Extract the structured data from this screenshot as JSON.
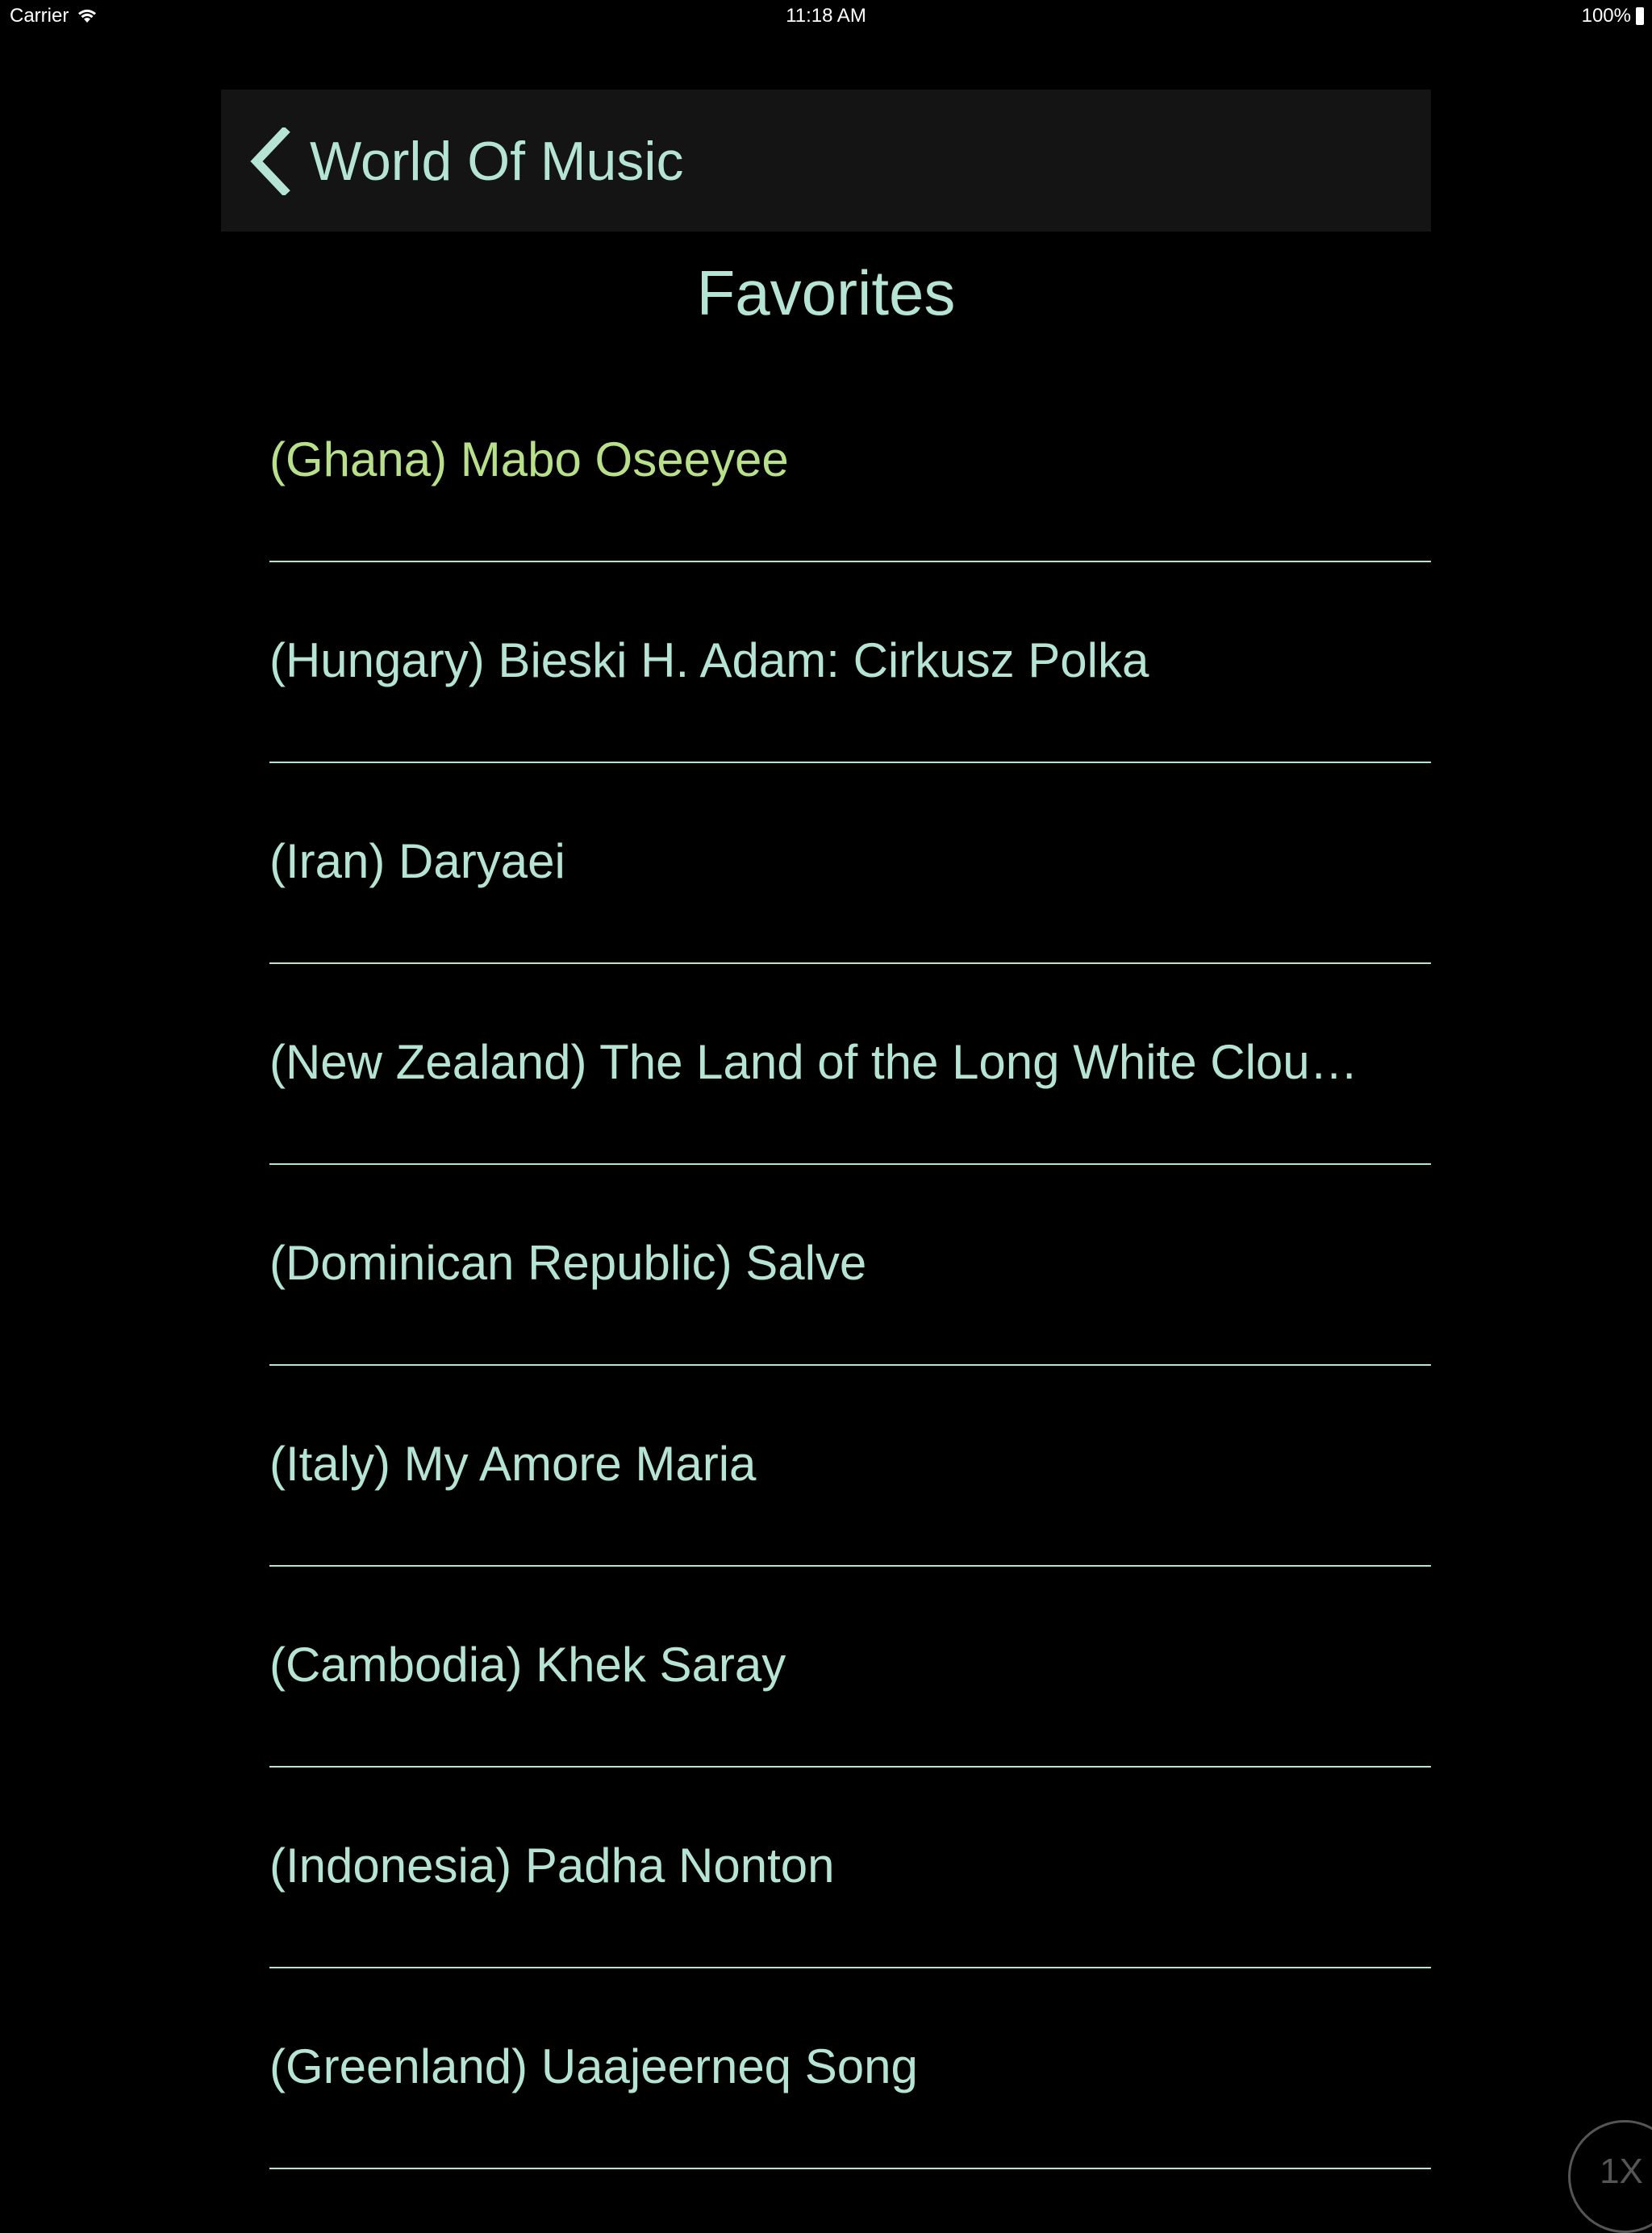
{
  "status_bar": {
    "carrier": "Carrier",
    "time": "11:18 AM",
    "battery": "100%"
  },
  "nav": {
    "back_label": "World Of Music"
  },
  "page": {
    "title": "Favorites"
  },
  "favorites": [
    {
      "label": "(Ghana) Mabo Oseeyee",
      "active": true
    },
    {
      "label": "(Hungary) Bieski H. Adam: Cirkusz Polka",
      "active": false
    },
    {
      "label": "(Iran) Daryaei",
      "active": false
    },
    {
      "label": "(New Zealand) The Land of the Long White Clou…",
      "active": false
    },
    {
      "label": "(Dominican Republic) Salve",
      "active": false
    },
    {
      "label": "(Italy) My Amore Maria",
      "active": false
    },
    {
      "label": "(Cambodia) Khek Saray",
      "active": false
    },
    {
      "label": "(Indonesia) Padha Nonton",
      "active": false
    },
    {
      "label": "(Greenland) Uaajeerneq Song",
      "active": false
    }
  ],
  "playback": {
    "speed_label": "1X"
  },
  "colors": {
    "background": "#000000",
    "text": "#b5e3d4",
    "active_text": "#b8e08a",
    "nav_bar": "#141414"
  }
}
